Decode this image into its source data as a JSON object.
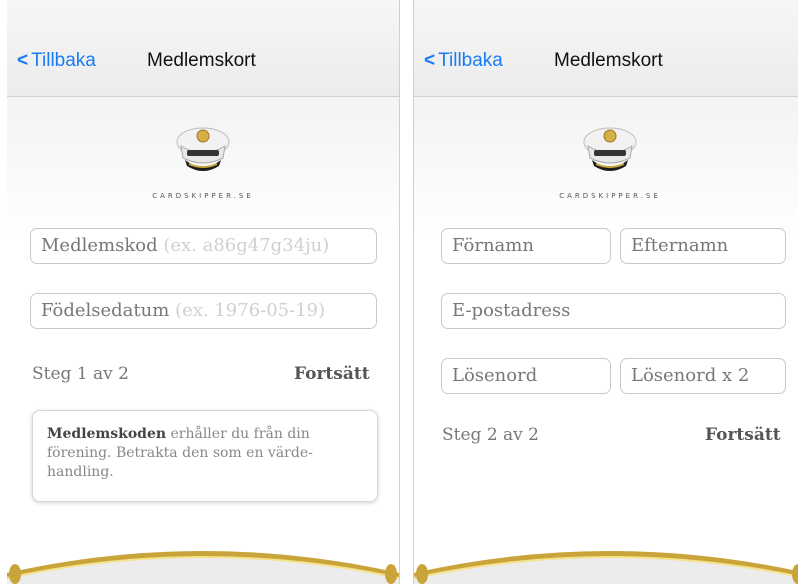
{
  "left": {
    "back_label": "Tillbaka",
    "title": "Medlemskort",
    "logo_text": "CARDSKIPPER.SE",
    "fields": {
      "code_label": "Medlemskod",
      "code_placeholder": "(ex. a86g47g34ju)",
      "dob_label": "Födelsedatum",
      "dob_placeholder": "(ex. 1976-05-19)"
    },
    "step": "Steg 1 av 2",
    "continue": "Fortsätt",
    "info": {
      "bold": "Medlemskoden",
      "text": " erhåller du från din förening. Betrakta den som en värde-handling."
    }
  },
  "right": {
    "back_label": "Tillbaka",
    "title": "Medlemskort",
    "logo_text": "CARDSKIPPER.SE",
    "fields": {
      "first_name": "Förnamn",
      "last_name": "Efternamn",
      "email": "E-postadress",
      "password": "Lösenord",
      "password_repeat": "Lösenord x 2"
    },
    "step": "Steg 2 av 2",
    "continue": "Fortsätt"
  },
  "colors": {
    "accent": "#1a7cf5",
    "gold": "#c9a43a"
  },
  "icons": {
    "back": "chevron-left-icon",
    "logo": "captain-hat-icon"
  }
}
